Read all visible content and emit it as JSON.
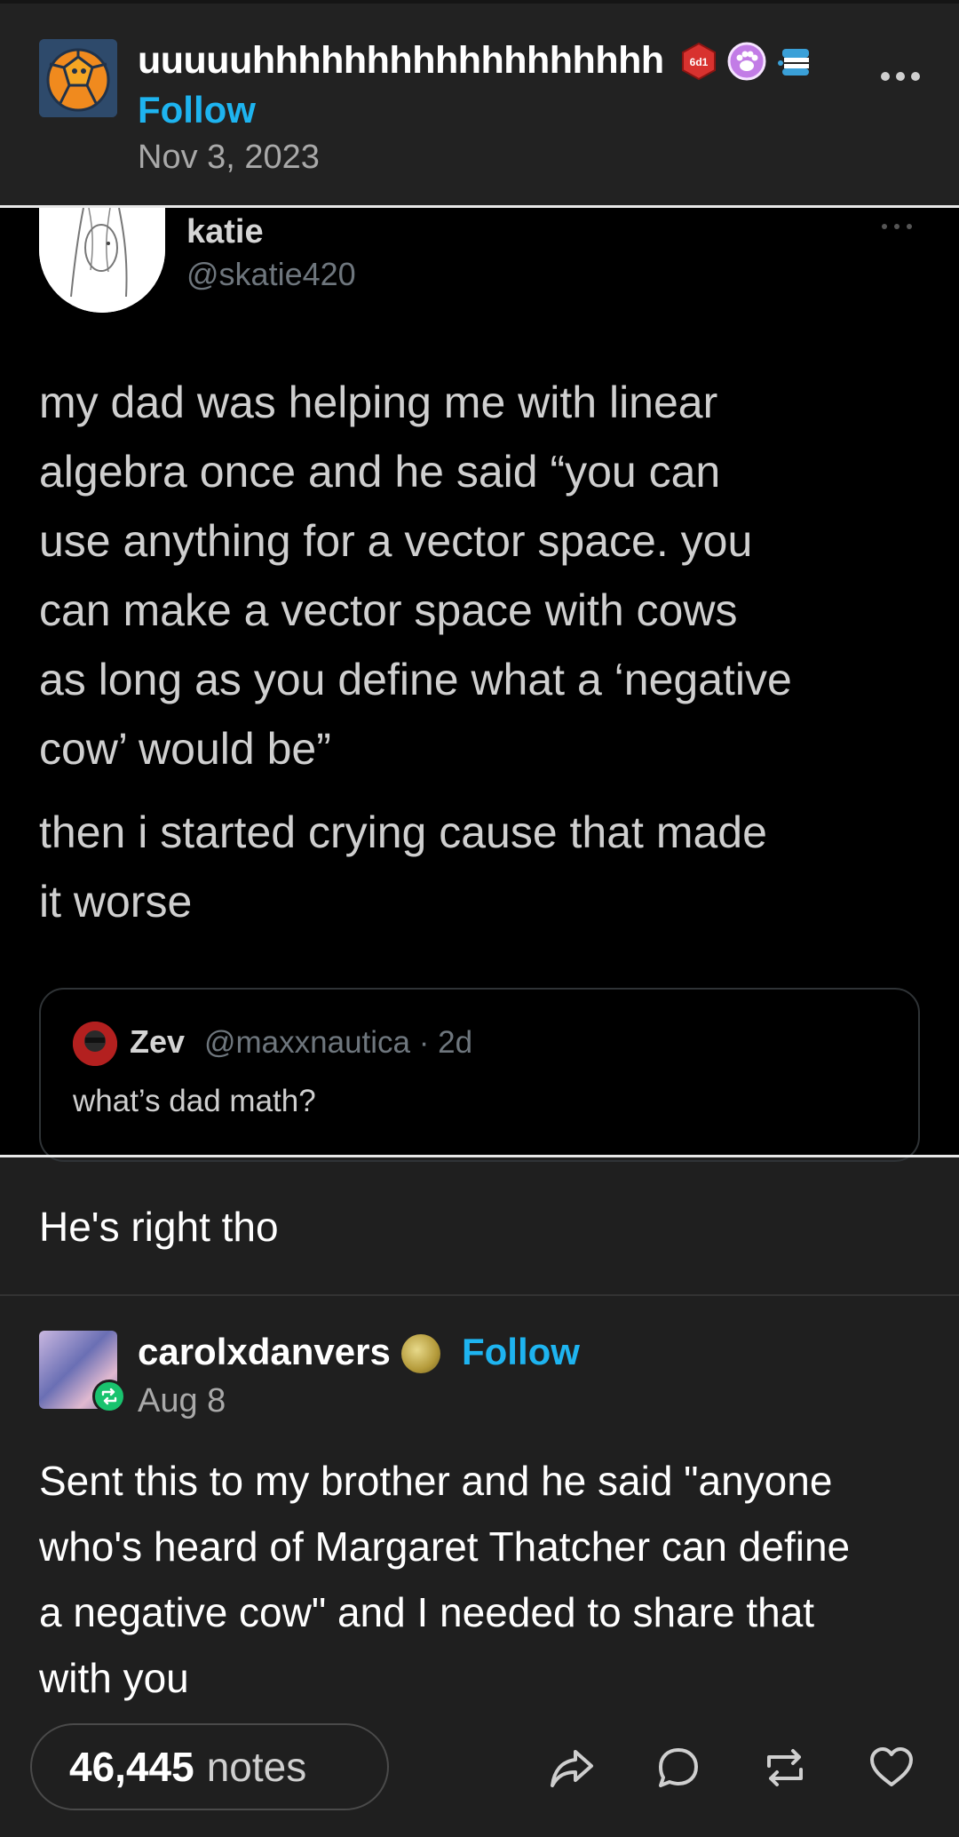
{
  "post": {
    "author": "uuuuuhhhhhhhhhhhhhhhhhh",
    "follow_label": "Follow",
    "date": "Nov 3, 2023",
    "badge_text": "6d1"
  },
  "tweet": {
    "name": "katie",
    "handle": "@skatie420",
    "text_lines": [
      "my dad was helping me with linear",
      "algebra once and he said “you can",
      "use anything for a vector space. you",
      "can make a vector space with cows",
      "as long as you define what a ‘negative",
      "cow’ would be”"
    ],
    "text2_lines": [
      "then i started crying cause that made",
      "it worse"
    ],
    "quote": {
      "name": "Zev",
      "meta": "@maxxnautica · 2d",
      "text": "what’s dad math?"
    }
  },
  "caption": "He's right tho",
  "reblog": {
    "author": "carolxdanvers",
    "follow_label": "Follow",
    "date": "Aug 8",
    "text_lines": [
      "Sent this to my brother and he said \"anyone",
      "who's heard of Margaret Thatcher can define",
      "a negative cow\" and I needed to share that",
      "with you"
    ]
  },
  "footer": {
    "notes_count": "46,445",
    "notes_label": "notes"
  },
  "colors": {
    "accent": "#1eb4f0",
    "background": "#1f1f1f",
    "reblog_green": "#19c36e"
  }
}
